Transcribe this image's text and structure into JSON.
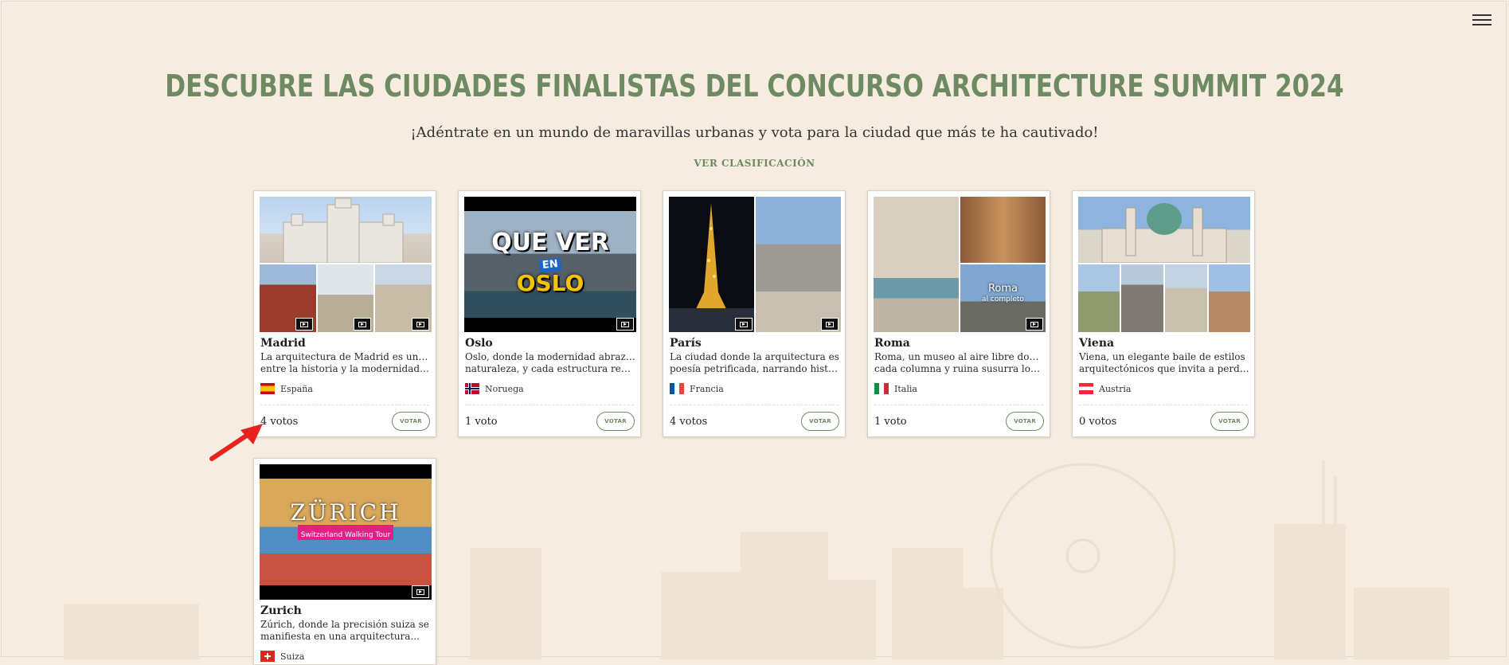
{
  "header": {
    "menu_icon": "hamburger-menu-icon",
    "title": "DESCUBRE LAS CIUDADES FINALISTAS DEL CONCURSO ARCHITECTURE SUMMIT 2024",
    "subtitle": "¡Adéntrate en un mundo de maravillas urbanas y vota para la ciudad que más te ha cautivado!",
    "ranking_link": "VER CLASIFICACIÓN"
  },
  "cards": [
    {
      "name": "Madrid",
      "desc1": "La arquitectura de Madrid es un diálogo",
      "desc2": "entre la historia y la modernidad, don...",
      "country": "España",
      "votes": "4 votos",
      "vote_label": "VOTAR"
    },
    {
      "name": "Oslo",
      "desc1": "Oslo, donde la modernidad abraza la",
      "desc2": "naturaleza, y cada estructura refleja la...",
      "country": "Noruega",
      "votes": "1 voto",
      "vote_label": "VOTAR",
      "thumb_text1": "QUE VER",
      "thumb_text2": "EN",
      "thumb_text3": "OSLO"
    },
    {
      "name": "París",
      "desc1": "La ciudad donde la arquitectura es",
      "desc2": "poesía petrificada, narrando historias ...",
      "country": "Francia",
      "votes": "4 votos",
      "vote_label": "VOTAR"
    },
    {
      "name": "Roma",
      "desc1": "Roma, un museo al aire libre donde",
      "desc2": "cada columna y ruina susurra los ecos...",
      "country": "Italia",
      "votes": "1 voto",
      "vote_label": "VOTAR",
      "thumb_text1": "Roma",
      "thumb_text2": "al completo"
    },
    {
      "name": "Viena",
      "desc1": "Viena, un elegante baile de estilos",
      "desc2": "arquitectónicos que invita a perderse ...",
      "country": "Austria",
      "votes": "0 votos",
      "vote_label": "VOTAR"
    },
    {
      "name": "Zurich",
      "desc1": "Zúrich, donde la precisión suiza se",
      "desc2": "manifiesta en una arquitectura...",
      "country": "Suiza",
      "votes": "",
      "vote_label": "",
      "thumb_text1": "ZÜRICH",
      "thumb_text2": "Switzerland Walking Tour"
    }
  ],
  "colors": {
    "accent": "#6e8a63",
    "background": "#f6ecdf",
    "annotation_arrow": "#e8231f"
  }
}
